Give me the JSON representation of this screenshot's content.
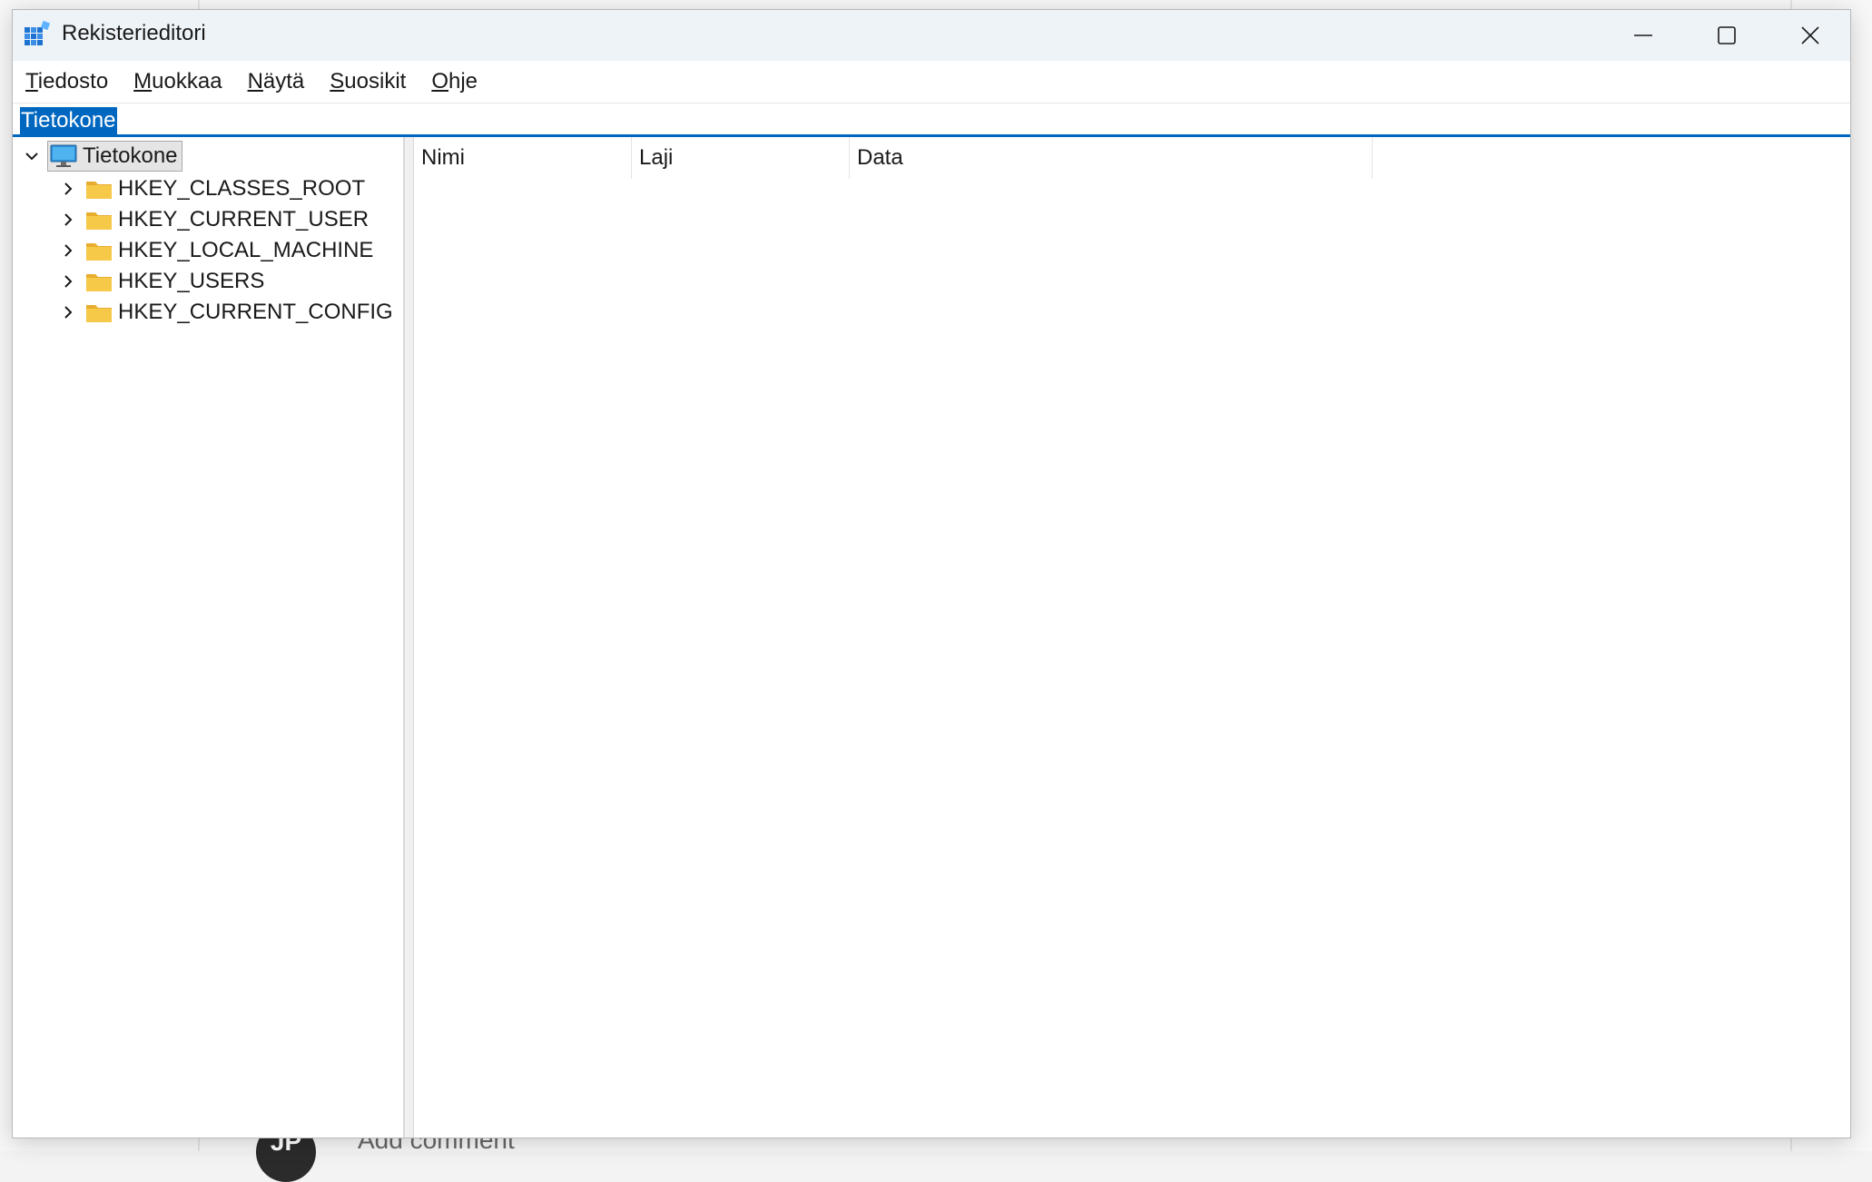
{
  "window": {
    "title": "Rekisterieditori"
  },
  "menu": [
    {
      "pre": "",
      "u": "T",
      "post": "iedosto"
    },
    {
      "pre": "",
      "u": "M",
      "post": "uokkaa"
    },
    {
      "pre": "",
      "u": "N",
      "post": "äytä"
    },
    {
      "pre": "",
      "u": "S",
      "post": "uosikit"
    },
    {
      "pre": "",
      "u": "O",
      "post": "hje"
    }
  ],
  "address": {
    "value": "Tietokone"
  },
  "tree": {
    "root": "Tietokone",
    "children": [
      "HKEY_CLASSES_ROOT",
      "HKEY_CURRENT_USER",
      "HKEY_LOCAL_MACHINE",
      "HKEY_USERS",
      "HKEY_CURRENT_CONFIG"
    ]
  },
  "columns": [
    "Nimi",
    "Laji",
    "Data"
  ],
  "background": {
    "avatar_text": "JP",
    "comment_text": "Add comment"
  },
  "icons": {
    "app": "registry-editor-icon",
    "root": "computer-monitor-icon",
    "child": "folder-icon"
  },
  "colors": {
    "accent": "#0067c0",
    "titlebar": "#eef3f8",
    "folder": "#f7c948"
  }
}
